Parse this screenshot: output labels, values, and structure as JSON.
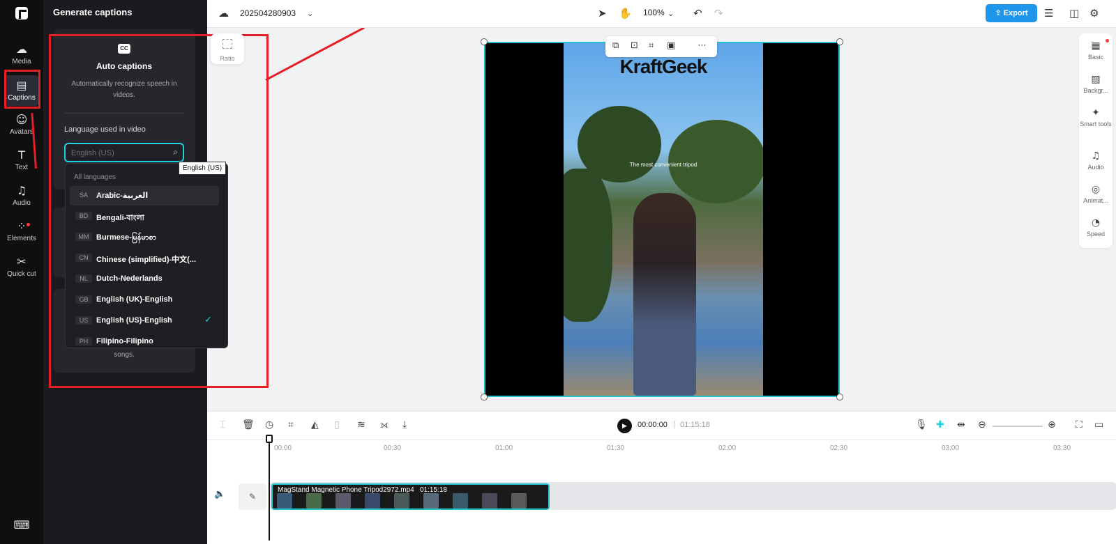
{
  "rail": {
    "items": [
      {
        "label": "Media",
        "icon": "cloud-upload-icon"
      },
      {
        "label": "Captions",
        "icon": "captions-icon"
      },
      {
        "label": "Avatars",
        "icon": "avatar-icon"
      },
      {
        "label": "Text",
        "icon": "text-icon"
      },
      {
        "label": "Audio",
        "icon": "music-note-icon"
      },
      {
        "label": "Elements",
        "icon": "elements-icon"
      },
      {
        "label": "Quick cut",
        "icon": "scissors-icon"
      }
    ],
    "keyboard_icon": "keyboard-icon"
  },
  "panel": {
    "title": "Generate captions",
    "auto": {
      "cc_icon": "CC",
      "title": "Auto captions",
      "description": "Automatically recognize speech in videos.",
      "language_label": "Language used in video",
      "language_placeholder": "English (US)"
    },
    "card3_text": "songs."
  },
  "dropdown": {
    "heading": "All languages",
    "tooltip": "English (US)",
    "items": [
      {
        "code": "SA",
        "name": "Arabic-العربية"
      },
      {
        "code": "BD",
        "name": "Bengali-বাংলা"
      },
      {
        "code": "MM",
        "name": "Burmese-မြန်မာစာ"
      },
      {
        "code": "CN",
        "name": "Chinese (simplified)-中文(..."
      },
      {
        "code": "NL",
        "name": "Dutch-Nederlands"
      },
      {
        "code": "GB",
        "name": "English (UK)-English"
      },
      {
        "code": "US",
        "name": "English (US)-English",
        "selected": true
      },
      {
        "code": "PH",
        "name": "Filipino-Filipino"
      }
    ]
  },
  "topbar": {
    "project_name": "202504280903",
    "zoom": "100%",
    "export_label": "Export"
  },
  "ratio_label": "Ratio",
  "video": {
    "brand_text": "KraftGeek",
    "subtitle": "The most convenient tripod"
  },
  "right_tools": [
    {
      "label": "Basic",
      "icon": "basic-icon"
    },
    {
      "label": "Backgr...",
      "icon": "background-icon"
    },
    {
      "label": "Smart tools",
      "icon": "magic-wand-icon"
    },
    {
      "label": "Audio",
      "icon": "music-note-icon"
    },
    {
      "label": "Animat...",
      "icon": "animation-icon"
    },
    {
      "label": "Speed",
      "icon": "speed-icon"
    }
  ],
  "playback": {
    "current_time": "00:00:00",
    "separator": "|",
    "total_time": "01:15:18"
  },
  "timeline": {
    "ticks": [
      "00:00",
      "00:30",
      "01:00",
      "01:30",
      "02:00",
      "02:30",
      "03:00",
      "03:30"
    ],
    "clip_name": "MagStand Magnetic Phone Tripod2972.mp4",
    "clip_duration": "01:15:18"
  },
  "colors": {
    "accent": "#1fd0dd",
    "export": "#1e96ea",
    "annotation": "#e31e24"
  }
}
